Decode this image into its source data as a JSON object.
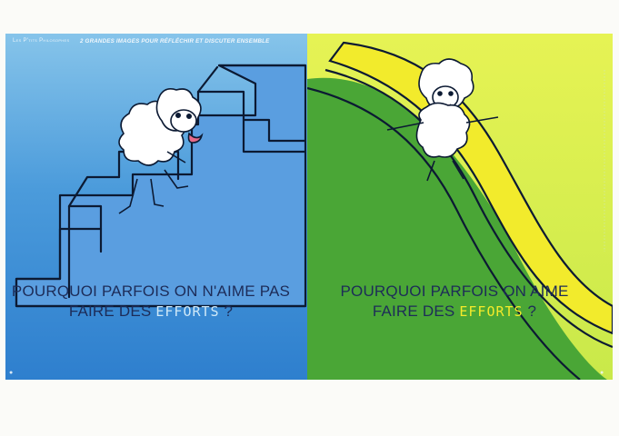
{
  "header": {
    "series": "Les P'tits Philosophes",
    "strapline": "2 GRANDES IMAGES POUR RÉFLÉCHIR ET DISCUTER ENSEMBLE"
  },
  "left_panel": {
    "question_line1": "POURQUOI PARFOIS ON N'AIME PAS",
    "question_line2_prefix": "FAIRE DES",
    "question_emphasis": "EFFORTS",
    "question_suffix": "?",
    "accent_color": "#cfe9f8"
  },
  "right_panel": {
    "question_line1": "POURQUOI PARFOIS ON AIME",
    "question_line2_prefix": "FAIRE DES",
    "question_emphasis": "EFFORTS",
    "question_suffix": "?",
    "accent_color": "#f4ea2a"
  },
  "illustrations": {
    "left": "sheep-climbing-stairs",
    "right": "sheep-on-slide"
  }
}
